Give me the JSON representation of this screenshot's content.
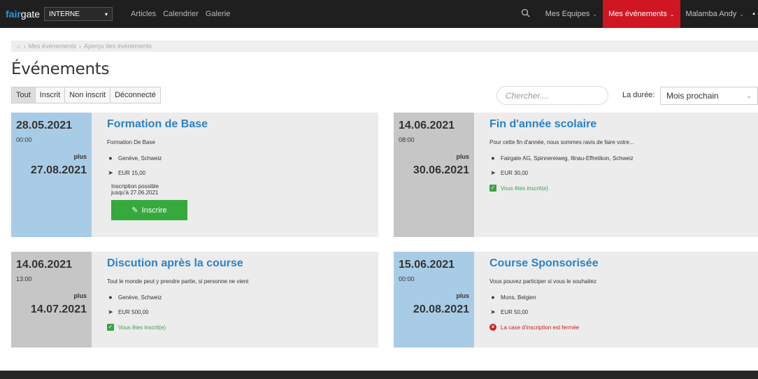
{
  "navbar": {
    "brand_part1": "fair",
    "brand_part2": "gate",
    "org_selector": "INTERNE",
    "links": [
      "Articles",
      "Calendrier",
      "Galerie"
    ],
    "right_items": [
      {
        "label": "Mes Equipes",
        "active": false
      },
      {
        "label": "Mes événements",
        "active": true
      },
      {
        "label": "Malamba Andy",
        "active": false
      }
    ]
  },
  "breadcrumb": {
    "items": [
      "Mes événements",
      "Aperçu des événements"
    ]
  },
  "page": {
    "title": "Événements"
  },
  "filters": {
    "tabs": [
      "Tout",
      "Inscrit",
      "Non inscrit",
      "Déconnecté"
    ],
    "active": "Tout"
  },
  "search": {
    "placeholder": "Chercher...."
  },
  "duration": {
    "label": "La durée:",
    "selected": "Mois prochain"
  },
  "events": [
    {
      "date_start": "28.05.2021",
      "time": "00:00",
      "plus": "plus",
      "date_end": "27.08.2021",
      "title": "Formation de Base",
      "description": "Formation De Base",
      "location": "Genève, Schweiz",
      "price": "EUR 15,00",
      "note_line1": "Inscription possible",
      "note_line2": "jusqu'à 27.06.2021",
      "button": "Inscrire"
    },
    {
      "date_start": "14.06.2021",
      "time": "08:00",
      "plus": "plus",
      "date_end": "30.06.2021",
      "title": "Fin d'année scolaire",
      "description": "Pour cette fin d'année, nous sommes ravis de faire votre...",
      "location": "Fairgate AG, Spinnereiweg, Illnau-Effretikon, Schweiz",
      "price": "EUR 30,00",
      "status": "Vous êtes inscrit(e)"
    },
    {
      "date_start": "14.06.2021",
      "time": "13:00",
      "plus": "plus",
      "date_end": "14.07.2021",
      "title": "Discution après la course",
      "description": "Tout le monde peut y prendre partie, si personne ne vient",
      "location": "Genève, Schweiz",
      "price": "EUR 500,00",
      "status": "Vous êtes inscrit(e)"
    },
    {
      "date_start": "15.06.2021",
      "time": "00:00",
      "plus": "plus",
      "date_end": "20.08.2021",
      "title": "Course Sponsorisée",
      "description": "Vous pouvez participer si vous le souhaitez",
      "location": "Mons, Belgien",
      "price": "EUR 50,00",
      "status": "La case d'inscription est fermée"
    }
  ],
  "colors": {
    "navbar_bg": "#1f1f1f",
    "active_nav": "#cf1622",
    "title_blue": "#2a82c9",
    "date_blue": "#a9cce6",
    "date_gray": "#c6c6c6",
    "success_green": "#36a93d",
    "error_red": "#cc2121"
  },
  "icons": [
    "search-icon",
    "home-icon",
    "map-marker-icon",
    "ticket-icon",
    "check-icon",
    "error-icon",
    "edit-icon",
    "chevron-down-icon"
  ]
}
